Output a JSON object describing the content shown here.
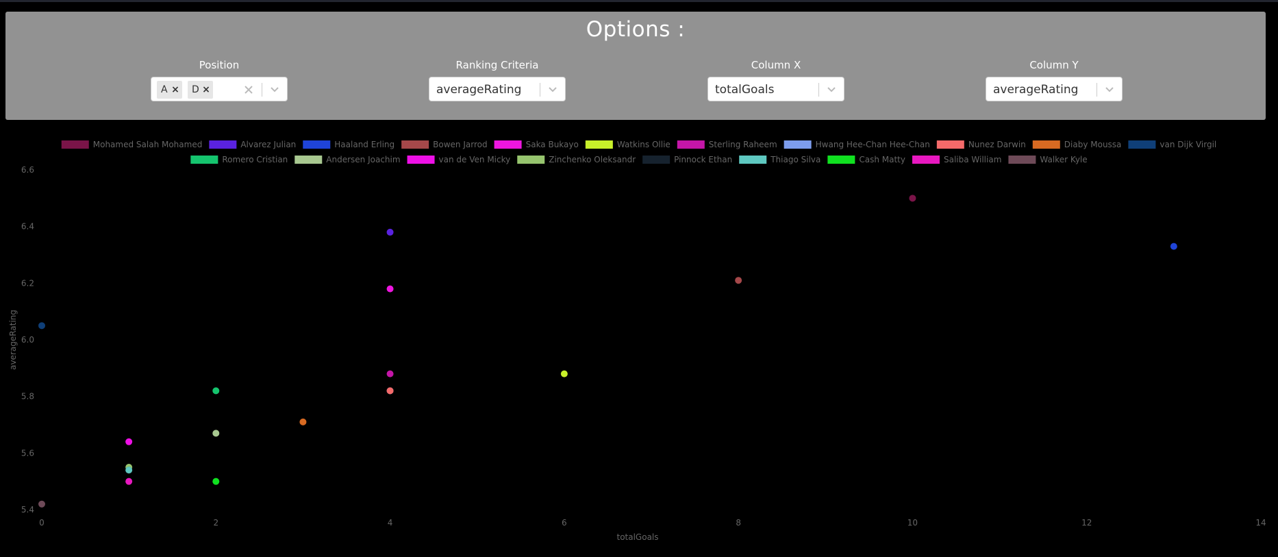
{
  "options": {
    "title": "Options :",
    "position": {
      "label": "Position",
      "selected": [
        "A",
        "D"
      ]
    },
    "ranking": {
      "label": "Ranking Criteria",
      "value": "averageRating"
    },
    "column_x": {
      "label": "Column X",
      "value": "totalGoals"
    },
    "column_y": {
      "label": "Column Y",
      "value": "averageRating"
    }
  },
  "chart_data": {
    "type": "scatter",
    "xlabel": "totalGoals",
    "ylabel": "averageRating",
    "xlim": [
      0,
      14
    ],
    "ylim": [
      5.4,
      6.6
    ],
    "xticks": [
      0,
      2,
      4,
      6,
      8,
      10,
      12,
      14
    ],
    "yticks": [
      5.4,
      5.6,
      5.8,
      6.0,
      6.2,
      6.4,
      6.6
    ],
    "grid": false,
    "legend": "top",
    "series": [
      {
        "name": "Mohamed Salah Mohamed",
        "color": "#7a1448",
        "x": 10,
        "y": 6.5
      },
      {
        "name": "Alvarez Julian",
        "color": "#5a22e0",
        "x": 4,
        "y": 6.38
      },
      {
        "name": "Haaland Erling",
        "color": "#1f44d8",
        "x": 13,
        "y": 6.33
      },
      {
        "name": "Bowen Jarrod",
        "color": "#a5484a",
        "x": 8,
        "y": 6.21
      },
      {
        "name": "Saka Bukayo",
        "color": "#ee16e0",
        "x": 4,
        "y": 6.18
      },
      {
        "name": "Watkins Ollie",
        "color": "#c8f02a",
        "x": 6,
        "y": 5.88
      },
      {
        "name": "Sterling Raheem",
        "color": "#c416a8",
        "x": 4,
        "y": 5.88
      },
      {
        "name": "Hwang Hee-Chan Hee-Chan",
        "color": "#7d9ded",
        "x": 4,
        "y": 5.82
      },
      {
        "name": "Nunez Darwin",
        "color": "#f46a6a",
        "x": 4,
        "y": 5.82
      },
      {
        "name": "Diaby Moussa",
        "color": "#d86a22",
        "x": 3,
        "y": 5.71
      },
      {
        "name": "van Dijk Virgil",
        "color": "#0f3f78",
        "x": 0,
        "y": 6.05
      },
      {
        "name": "Romero Cristian",
        "color": "#15c46e",
        "x": 2,
        "y": 5.82
      },
      {
        "name": "Andersen Joachim",
        "color": "#a8c890",
        "x": 2,
        "y": 5.67
      },
      {
        "name": "van de Ven Micky",
        "color": "#ee10e6",
        "x": 1,
        "y": 5.64
      },
      {
        "name": "Zinchenko Oleksandr",
        "color": "#96c46e",
        "x": 1,
        "y": 5.55
      },
      {
        "name": "Pinnock Ethan",
        "color": "#16222e",
        "x": 1,
        "y": 5.54
      },
      {
        "name": "Thiago Silva",
        "color": "#5ec8c0",
        "x": 1,
        "y": 5.54
      },
      {
        "name": "Cash Matty",
        "color": "#10e020",
        "x": 2,
        "y": 5.5
      },
      {
        "name": "Saliba William",
        "color": "#e818c0",
        "x": 1,
        "y": 5.5
      },
      {
        "name": "Walker Kyle",
        "color": "#6e4a58",
        "x": 0,
        "y": 5.42
      }
    ]
  }
}
